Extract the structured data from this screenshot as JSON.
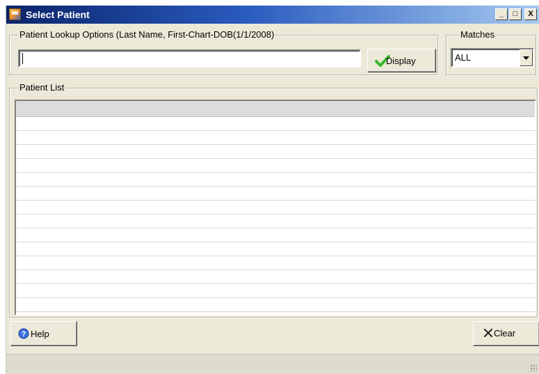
{
  "window": {
    "title": "Select Patient",
    "controls": {
      "minimize": "_",
      "maximize": "□",
      "close": "X"
    }
  },
  "lookup": {
    "legend": "Patient Lookup Options (Last Name, First-Chart-DOB(1/1/2008)",
    "value": "",
    "display_label": "Display",
    "display_icon": "green-check-icon"
  },
  "matches": {
    "legend": "Matches",
    "selected": "ALL"
  },
  "patient_list": {
    "legend": "Patient List",
    "rows": []
  },
  "footer": {
    "help_label": "Help",
    "help_icon": "help-question-icon",
    "clear_label": "Clear",
    "clear_icon": "x-icon"
  },
  "colors": {
    "titlebar_start": "#0a246a",
    "titlebar_end": "#a6caf0",
    "face": "#ece9d8",
    "check_green": "#35b82a",
    "help_blue": "#3a6ee0"
  }
}
